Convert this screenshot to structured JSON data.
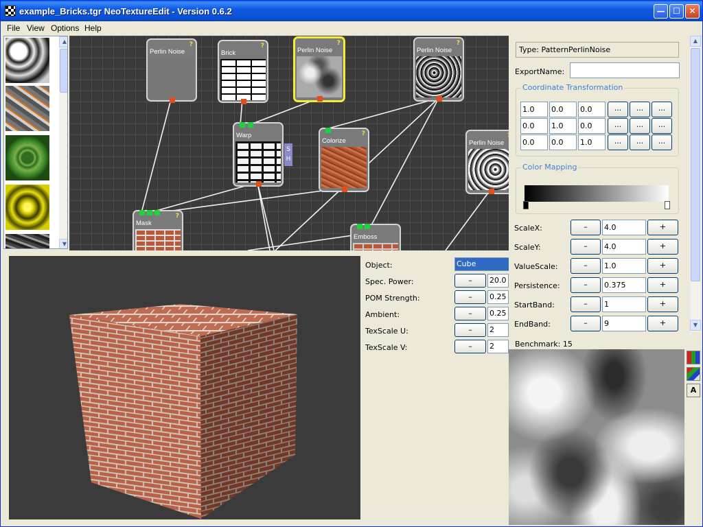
{
  "window": {
    "title": "example_Bricks.tgr NeoTextureEdit - Version 0.6.2",
    "min_glyph": "—",
    "max_glyph": "☐",
    "close_glyph": "✕"
  },
  "menu": [
    "File",
    "View",
    "Options",
    "Help"
  ],
  "thumbnails": [
    "marble-pattern-icon",
    "lava-rock-icon",
    "green-cells-icon",
    "yellow-star-icon",
    "dark-rock-icon"
  ],
  "graph": {
    "nodes": [
      {
        "id": "perlin1",
        "title": "Perlin Noise",
        "help": "?"
      },
      {
        "id": "brick",
        "title": "Brick",
        "help": "?"
      },
      {
        "id": "perlin2",
        "title": "Perlin Noise",
        "help": "?"
      },
      {
        "id": "perlin3",
        "title": "Perlin Noise",
        "help": "?"
      },
      {
        "id": "warp",
        "title": "Warp",
        "help": "?"
      },
      {
        "id": "colorize",
        "title": "Colorize",
        "help": "?"
      },
      {
        "id": "perlin4",
        "title": "Perlin Noise",
        "help": "?"
      },
      {
        "id": "mask",
        "title": "Mask",
        "help": "?"
      },
      {
        "id": "emboss",
        "title": "Emboss",
        "help": "?"
      }
    ],
    "sh_tab": {
      "s": "S",
      "h": "H"
    }
  },
  "viewer3d": {
    "object_label": "Object:",
    "object_value": "Cube",
    "params": [
      {
        "label": "Spec. Power:",
        "minus": "–",
        "value": "20.0"
      },
      {
        "label": "POM Strength:",
        "minus": "–",
        "value": "0.25"
      },
      {
        "label": "Ambient:",
        "minus": "–",
        "value": "0.25"
      },
      {
        "label": "TexScale U:",
        "minus": "–",
        "value": "2"
      },
      {
        "label": "TexScale V:",
        "minus": "–",
        "value": "2"
      }
    ]
  },
  "properties": {
    "type": "Type: PatternPerlinNoise",
    "export_label": "ExportName:",
    "export_value": "",
    "coord_title": "Coordinate Transformation",
    "matrix": [
      [
        "1.0",
        "0.0",
        "0.0"
      ],
      [
        "0.0",
        "1.0",
        "0.0"
      ],
      [
        "0.0",
        "0.0",
        "1.0"
      ]
    ],
    "dots": "...",
    "color_title": "Color Mapping",
    "params": [
      {
        "label": "ScaleX:",
        "minus": "–",
        "value": "4.0",
        "plus": "+"
      },
      {
        "label": "ScaleY:",
        "minus": "–",
        "value": "4.0",
        "plus": "+"
      },
      {
        "label": "ValueScale:",
        "minus": "–",
        "value": "1.0",
        "plus": "+"
      },
      {
        "label": "Persistence:",
        "minus": "–",
        "value": "0.375",
        "plus": "+"
      },
      {
        "label": "StartBand:",
        "minus": "–",
        "value": "1",
        "plus": "+"
      },
      {
        "label": "EndBand:",
        "minus": "–",
        "value": "9",
        "plus": "+"
      }
    ]
  },
  "benchmark": "Benchmark: 15",
  "preview_tools": [
    "rgb-channels-icon",
    "rgba-channels-icon",
    "alpha-channel-icon"
  ],
  "preview_tool_labels": {
    "alpha": "A"
  }
}
